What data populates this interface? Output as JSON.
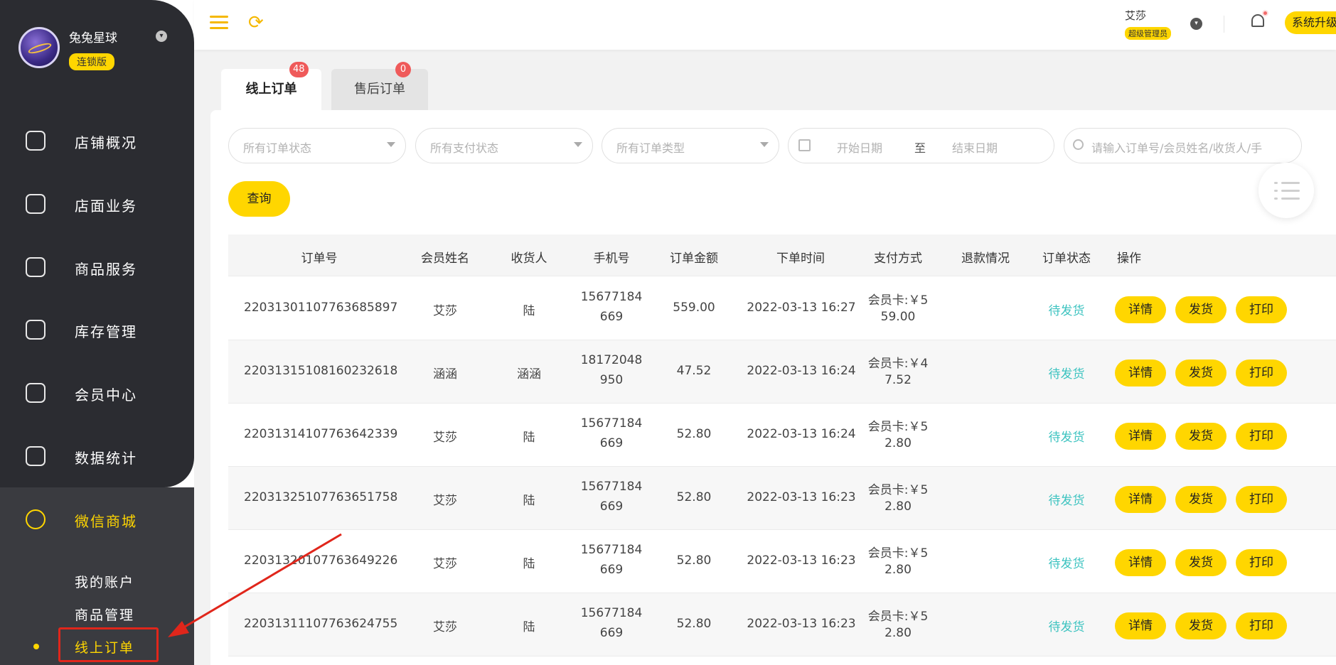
{
  "sidebar": {
    "brand_name": "兔兔星球",
    "brand_badge": "连锁版",
    "nav": [
      {
        "label": "店铺概况",
        "icon": "monitor-icon"
      },
      {
        "label": "店面业务",
        "icon": "home-icon"
      },
      {
        "label": "商品服务",
        "icon": "bag-icon"
      },
      {
        "label": "库存管理",
        "icon": "box-icon"
      },
      {
        "label": "会员中心",
        "icon": "member-icon"
      },
      {
        "label": "数据统计",
        "icon": "chart-icon"
      },
      {
        "label": "微信商城",
        "icon": "wechat-icon"
      }
    ],
    "sub": [
      "我的账户",
      "商品管理",
      "线上订单"
    ]
  },
  "topbar": {
    "user_name": "艾莎",
    "user_role": "超级管理员",
    "upgrade_label": "系统升级"
  },
  "tabs": [
    {
      "label": "线上订单",
      "badge": "48"
    },
    {
      "label": "售后订单",
      "badge": "0"
    }
  ],
  "filters": {
    "order_status": "所有订单状态",
    "pay_status": "所有支付状态",
    "order_type": "所有订单类型",
    "start_date": "开始日期",
    "date_sep": "至",
    "end_date": "结束日期",
    "search_placeholder": "请输入订单号/会员姓名/收货人/手",
    "query_label": "查询"
  },
  "table": {
    "headers": [
      "订单号",
      "会员姓名",
      "收货人",
      "手机号",
      "订单金额",
      "下单时间",
      "支付方式",
      "退款情况",
      "订单状态",
      "操作"
    ],
    "actions": [
      "详情",
      "发货",
      "打印"
    ],
    "rows": [
      {
        "order_no": "22031301107763685897",
        "member": "艾莎",
        "receiver": "陆",
        "phone1": "15677184",
        "phone2": "669",
        "amount": "559.00",
        "time": "2022-03-13 16:27",
        "pay1": "会员卡:￥5",
        "pay2": "59.00",
        "refund": "",
        "status": "待发货"
      },
      {
        "order_no": "22031315108160232618",
        "member": "涵涵",
        "receiver": "涵涵",
        "phone1": "18172048",
        "phone2": "950",
        "amount": "47.52",
        "time": "2022-03-13 16:24",
        "pay1": "会员卡:￥4",
        "pay2": "7.52",
        "refund": "",
        "status": "待发货"
      },
      {
        "order_no": "22031314107763642339",
        "member": "艾莎",
        "receiver": "陆",
        "phone1": "15677184",
        "phone2": "669",
        "amount": "52.80",
        "time": "2022-03-13 16:24",
        "pay1": "会员卡:￥5",
        "pay2": "2.80",
        "refund": "",
        "status": "待发货"
      },
      {
        "order_no": "22031325107763651758",
        "member": "艾莎",
        "receiver": "陆",
        "phone1": "15677184",
        "phone2": "669",
        "amount": "52.80",
        "time": "2022-03-13 16:23",
        "pay1": "会员卡:￥5",
        "pay2": "2.80",
        "refund": "",
        "status": "待发货"
      },
      {
        "order_no": "22031320107763649226",
        "member": "艾莎",
        "receiver": "陆",
        "phone1": "15677184",
        "phone2": "669",
        "amount": "52.80",
        "time": "2022-03-13 16:23",
        "pay1": "会员卡:￥5",
        "pay2": "2.80",
        "refund": "",
        "status": "待发货"
      },
      {
        "order_no": "22031311107763624755",
        "member": "艾莎",
        "receiver": "陆",
        "phone1": "15677184",
        "phone2": "669",
        "amount": "52.80",
        "time": "2022-03-13 16:23",
        "pay1": "会员卡:￥5",
        "pay2": "2.80",
        "refund": "",
        "status": "待发货"
      }
    ]
  },
  "colors": {
    "accent": "#ffd600",
    "sidebar_bg": "#2b2c31",
    "status": "#3cc3c0",
    "annotation": "#e0261b"
  }
}
